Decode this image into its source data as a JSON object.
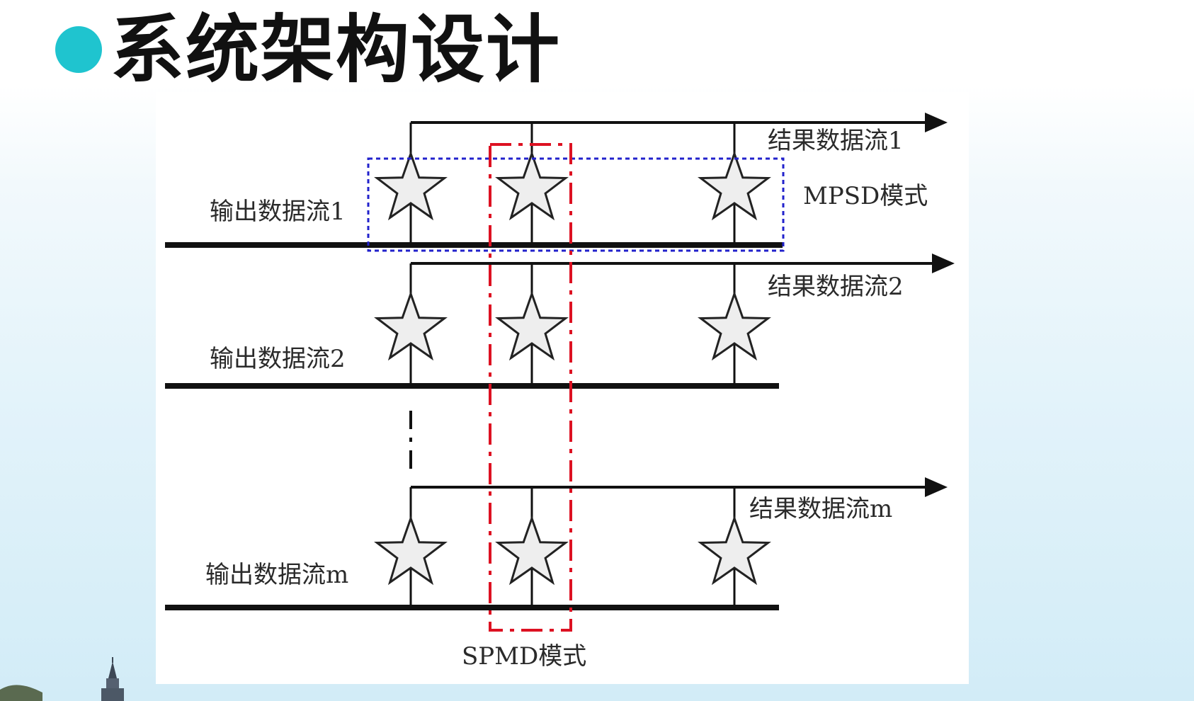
{
  "slide": {
    "title": "系统架构设计",
    "bullet_color": "#1fc4cf"
  },
  "diagram": {
    "rows": [
      {
        "input_label": "输出数据流1",
        "output_label": "结果数据流1"
      },
      {
        "input_label": "输出数据流2",
        "output_label": "结果数据流2"
      },
      {
        "input_label": "输出数据流m",
        "output_label": "结果数据流m"
      }
    ],
    "mpsd_label": "MPSD模式",
    "spmd_label": "SPMD模式",
    "colors": {
      "mpsd_box": "#2222cc",
      "spmd_box": "#dd1122",
      "star_fill": "#eeeeee",
      "line": "#111111"
    }
  }
}
